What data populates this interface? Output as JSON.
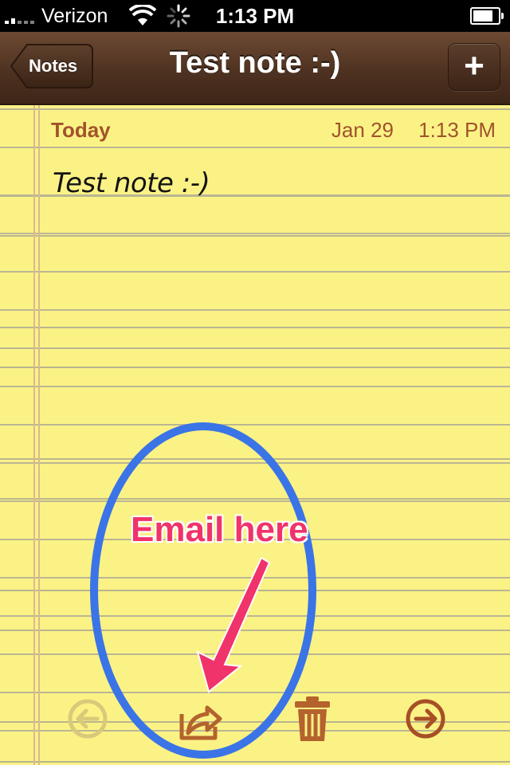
{
  "status_bar": {
    "carrier": "Verizon",
    "time": "1:13 PM",
    "battery_level": 0.8
  },
  "nav_bar": {
    "title": "Test note :-)",
    "back_label": "Notes",
    "add_label": "+"
  },
  "note": {
    "date_label": "Today",
    "date": "Jan 29",
    "time": "1:13 PM",
    "body": "Test note :-)"
  },
  "toolbar": {
    "items": [
      "back-arrow-icon",
      "share-icon",
      "trash-icon",
      "next-arrow-icon"
    ]
  },
  "annotation": {
    "text": "Email here",
    "ellipse_color": "#3a74e6",
    "arrow_color": "#f0336a"
  },
  "colors": {
    "paper": "#fbf286",
    "nav": "#4e3221",
    "accent_text": "#a0532a"
  }
}
